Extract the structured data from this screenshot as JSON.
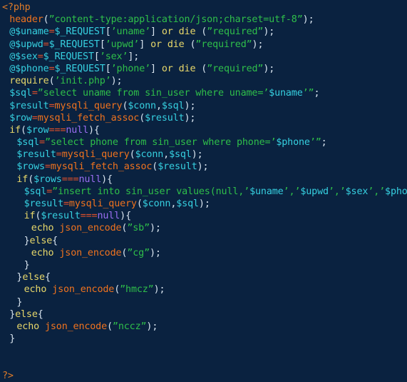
{
  "editor": {
    "name": "php-source-view",
    "language": "PHP",
    "background_color": "#0a2240",
    "colors": {
      "tag": "#e07b28",
      "keyword": "#e8d86a",
      "function": "#f0731e",
      "variable": "#36d0e0",
      "string": "#2fbf4a",
      "null_literal": "#9b6ef3",
      "operator": "#e0502a",
      "punctuation": "#d8e4ef"
    },
    "lines": [
      {
        "indent": 0,
        "tokens": [
          {
            "t": "<?php",
            "c": "tag"
          }
        ]
      },
      {
        "indent": 1,
        "tokens": [
          {
            "t": "header",
            "c": "fn"
          },
          {
            "t": "(",
            "c": "punct"
          },
          {
            "t": "”content-type:application/json;charset=utf-8”",
            "c": "str"
          },
          {
            "t": ")",
            "c": "punct"
          },
          {
            "t": ";",
            "c": "punct"
          }
        ]
      },
      {
        "indent": 1,
        "tokens": [
          {
            "t": "@$uname",
            "c": "var"
          },
          {
            "t": "=",
            "c": "op"
          },
          {
            "t": "$_REQUEST",
            "c": "var"
          },
          {
            "t": "[",
            "c": "punct"
          },
          {
            "t": "’uname’",
            "c": "str"
          },
          {
            "t": "]",
            "c": "punct"
          },
          {
            "t": " ",
            "c": "plain"
          },
          {
            "t": "or",
            "c": "kw"
          },
          {
            "t": " ",
            "c": "plain"
          },
          {
            "t": "die",
            "c": "kw"
          },
          {
            "t": " ",
            "c": "plain"
          },
          {
            "t": "(",
            "c": "punct"
          },
          {
            "t": "”required”",
            "c": "str"
          },
          {
            "t": ")",
            "c": "punct"
          },
          {
            "t": ";",
            "c": "punct"
          }
        ]
      },
      {
        "indent": 1,
        "tokens": [
          {
            "t": "@$upwd",
            "c": "var"
          },
          {
            "t": "=",
            "c": "op"
          },
          {
            "t": "$_REQUEST",
            "c": "var"
          },
          {
            "t": "[",
            "c": "punct"
          },
          {
            "t": "’upwd’",
            "c": "str"
          },
          {
            "t": "]",
            "c": "punct"
          },
          {
            "t": " ",
            "c": "plain"
          },
          {
            "t": "or",
            "c": "kw"
          },
          {
            "t": " ",
            "c": "plain"
          },
          {
            "t": "die",
            "c": "kw"
          },
          {
            "t": " ",
            "c": "plain"
          },
          {
            "t": "(",
            "c": "punct"
          },
          {
            "t": "”required”",
            "c": "str"
          },
          {
            "t": ")",
            "c": "punct"
          },
          {
            "t": ";",
            "c": "punct"
          }
        ]
      },
      {
        "indent": 1,
        "tokens": [
          {
            "t": "@$sex",
            "c": "var"
          },
          {
            "t": "=",
            "c": "op"
          },
          {
            "t": "$_REQUEST",
            "c": "var"
          },
          {
            "t": "[",
            "c": "punct"
          },
          {
            "t": "’sex’",
            "c": "str"
          },
          {
            "t": "]",
            "c": "punct"
          },
          {
            "t": ";",
            "c": "punct"
          }
        ]
      },
      {
        "indent": 1,
        "tokens": [
          {
            "t": "@$phone",
            "c": "var"
          },
          {
            "t": "=",
            "c": "op"
          },
          {
            "t": "$_REQUEST",
            "c": "var"
          },
          {
            "t": "[",
            "c": "punct"
          },
          {
            "t": "’phone’",
            "c": "str"
          },
          {
            "t": "]",
            "c": "punct"
          },
          {
            "t": " ",
            "c": "plain"
          },
          {
            "t": "or",
            "c": "kw"
          },
          {
            "t": " ",
            "c": "plain"
          },
          {
            "t": "die",
            "c": "kw"
          },
          {
            "t": " ",
            "c": "plain"
          },
          {
            "t": "(",
            "c": "punct"
          },
          {
            "t": "”required”",
            "c": "str"
          },
          {
            "t": ")",
            "c": "punct"
          },
          {
            "t": ";",
            "c": "punct"
          }
        ]
      },
      {
        "indent": 1,
        "tokens": [
          {
            "t": "require",
            "c": "kw"
          },
          {
            "t": "(",
            "c": "punct"
          },
          {
            "t": "’init.php’",
            "c": "str"
          },
          {
            "t": ")",
            "c": "punct"
          },
          {
            "t": ";",
            "c": "punct"
          }
        ]
      },
      {
        "indent": 1,
        "tokens": [
          {
            "t": "$sql",
            "c": "var"
          },
          {
            "t": "=",
            "c": "op"
          },
          {
            "t": "”select uname from sin_user where uname=’",
            "c": "str"
          },
          {
            "t": "$uname",
            "c": "var"
          },
          {
            "t": "’”",
            "c": "str"
          },
          {
            "t": ";",
            "c": "punct"
          }
        ]
      },
      {
        "indent": 1,
        "tokens": [
          {
            "t": "$result",
            "c": "var"
          },
          {
            "t": "=",
            "c": "op"
          },
          {
            "t": "mysqli_query",
            "c": "fn"
          },
          {
            "t": "(",
            "c": "punct"
          },
          {
            "t": "$conn",
            "c": "var"
          },
          {
            "t": ",",
            "c": "punct"
          },
          {
            "t": "$sql",
            "c": "var"
          },
          {
            "t": ")",
            "c": "punct"
          },
          {
            "t": ";",
            "c": "punct"
          }
        ]
      },
      {
        "indent": 1,
        "tokens": [
          {
            "t": "$row",
            "c": "var"
          },
          {
            "t": "=",
            "c": "op"
          },
          {
            "t": "mysqli_fetch_assoc",
            "c": "fn"
          },
          {
            "t": "(",
            "c": "punct"
          },
          {
            "t": "$result",
            "c": "var"
          },
          {
            "t": ")",
            "c": "punct"
          },
          {
            "t": ";",
            "c": "punct"
          }
        ]
      },
      {
        "indent": 1,
        "tokens": [
          {
            "t": "if",
            "c": "kw"
          },
          {
            "t": "(",
            "c": "punct"
          },
          {
            "t": "$row",
            "c": "var"
          },
          {
            "t": "===",
            "c": "op"
          },
          {
            "t": "null",
            "c": "null"
          },
          {
            "t": ")",
            "c": "punct"
          },
          {
            "t": "{",
            "c": "punct"
          }
        ]
      },
      {
        "indent": 2,
        "tokens": [
          {
            "t": "$sql",
            "c": "var"
          },
          {
            "t": "=",
            "c": "op"
          },
          {
            "t": "”select phone from sin_user where phone=’",
            "c": "str"
          },
          {
            "t": "$phone",
            "c": "var"
          },
          {
            "t": "’”",
            "c": "str"
          },
          {
            "t": ";",
            "c": "punct"
          }
        ]
      },
      {
        "indent": 2,
        "tokens": [
          {
            "t": "$result",
            "c": "var"
          },
          {
            "t": "=",
            "c": "op"
          },
          {
            "t": "mysqli_query",
            "c": "fn"
          },
          {
            "t": "(",
            "c": "punct"
          },
          {
            "t": "$conn",
            "c": "var"
          },
          {
            "t": ",",
            "c": "punct"
          },
          {
            "t": "$sql",
            "c": "var"
          },
          {
            "t": ")",
            "c": "punct"
          },
          {
            "t": ";",
            "c": "punct"
          }
        ]
      },
      {
        "indent": 2,
        "tokens": [
          {
            "t": "$rows",
            "c": "var"
          },
          {
            "t": "=",
            "c": "op"
          },
          {
            "t": "mysqli_fetch_assoc",
            "c": "fn"
          },
          {
            "t": "(",
            "c": "punct"
          },
          {
            "t": "$result",
            "c": "var"
          },
          {
            "t": ")",
            "c": "punct"
          },
          {
            "t": ";",
            "c": "punct"
          }
        ]
      },
      {
        "indent": 2,
        "tokens": [
          {
            "t": "if",
            "c": "kw"
          },
          {
            "t": "(",
            "c": "punct"
          },
          {
            "t": "$rows",
            "c": "var"
          },
          {
            "t": "===",
            "c": "op"
          },
          {
            "t": "null",
            "c": "null"
          },
          {
            "t": ")",
            "c": "punct"
          },
          {
            "t": "{",
            "c": "punct"
          }
        ]
      },
      {
        "indent": 3,
        "tokens": [
          {
            "t": "$sql",
            "c": "var"
          },
          {
            "t": "=",
            "c": "op"
          },
          {
            "t": "”insert into sin_user values(null,’",
            "c": "str"
          },
          {
            "t": "$uname",
            "c": "var"
          },
          {
            "t": "’,’",
            "c": "str"
          },
          {
            "t": "$upwd",
            "c": "var"
          },
          {
            "t": "’,’",
            "c": "str"
          },
          {
            "t": "$sex",
            "c": "var"
          },
          {
            "t": "’,’",
            "c": "str"
          },
          {
            "t": "$phone",
            "c": "var"
          },
          {
            "t": "’)”",
            "c": "str"
          },
          {
            "t": ";",
            "c": "punct"
          }
        ]
      },
      {
        "indent": 3,
        "tokens": [
          {
            "t": "$result",
            "c": "var"
          },
          {
            "t": "=",
            "c": "op"
          },
          {
            "t": "mysqli_query",
            "c": "fn"
          },
          {
            "t": "(",
            "c": "punct"
          },
          {
            "t": "$conn",
            "c": "var"
          },
          {
            "t": ",",
            "c": "punct"
          },
          {
            "t": "$sql",
            "c": "var"
          },
          {
            "t": ")",
            "c": "punct"
          },
          {
            "t": ";",
            "c": "punct"
          }
        ]
      },
      {
        "indent": 3,
        "tokens": [
          {
            "t": "if",
            "c": "kw"
          },
          {
            "t": "(",
            "c": "punct"
          },
          {
            "t": "$result",
            "c": "var"
          },
          {
            "t": "===",
            "c": "op"
          },
          {
            "t": "null",
            "c": "null"
          },
          {
            "t": ")",
            "c": "punct"
          },
          {
            "t": "{",
            "c": "punct"
          }
        ]
      },
      {
        "indent": 4,
        "tokens": [
          {
            "t": "echo",
            "c": "kw"
          },
          {
            "t": " ",
            "c": "plain"
          },
          {
            "t": "json_encode",
            "c": "fn"
          },
          {
            "t": "(",
            "c": "punct"
          },
          {
            "t": "”sb”",
            "c": "str"
          },
          {
            "t": ")",
            "c": "punct"
          },
          {
            "t": ";",
            "c": "punct"
          }
        ]
      },
      {
        "indent": 3,
        "tokens": [
          {
            "t": "}",
            "c": "punct"
          },
          {
            "t": "else",
            "c": "kw"
          },
          {
            "t": "{",
            "c": "punct"
          }
        ]
      },
      {
        "indent": 4,
        "tokens": [
          {
            "t": "echo",
            "c": "kw"
          },
          {
            "t": " ",
            "c": "plain"
          },
          {
            "t": "json_encode",
            "c": "fn"
          },
          {
            "t": "(",
            "c": "punct"
          },
          {
            "t": "”cg”",
            "c": "str"
          },
          {
            "t": ")",
            "c": "punct"
          },
          {
            "t": ";",
            "c": "punct"
          }
        ]
      },
      {
        "indent": 3,
        "tokens": [
          {
            "t": "}",
            "c": "punct"
          }
        ]
      },
      {
        "indent": 2,
        "tokens": [
          {
            "t": "}",
            "c": "punct"
          },
          {
            "t": "else",
            "c": "kw"
          },
          {
            "t": "{",
            "c": "punct"
          }
        ]
      },
      {
        "indent": 3,
        "tokens": [
          {
            "t": "echo",
            "c": "kw"
          },
          {
            "t": " ",
            "c": "plain"
          },
          {
            "t": "json_encode",
            "c": "fn"
          },
          {
            "t": "(",
            "c": "punct"
          },
          {
            "t": "”hmcz”",
            "c": "str"
          },
          {
            "t": ")",
            "c": "punct"
          },
          {
            "t": ";",
            "c": "punct"
          }
        ]
      },
      {
        "indent": 2,
        "tokens": [
          {
            "t": "}",
            "c": "punct"
          }
        ]
      },
      {
        "indent": 1,
        "tokens": [
          {
            "t": "}",
            "c": "punct"
          },
          {
            "t": "else",
            "c": "kw"
          },
          {
            "t": "{",
            "c": "punct"
          }
        ]
      },
      {
        "indent": 2,
        "tokens": [
          {
            "t": "echo",
            "c": "kw"
          },
          {
            "t": " ",
            "c": "plain"
          },
          {
            "t": "json_encode",
            "c": "fn"
          },
          {
            "t": "(",
            "c": "punct"
          },
          {
            "t": "”nccz”",
            "c": "str"
          },
          {
            "t": ")",
            "c": "punct"
          },
          {
            "t": ";",
            "c": "punct"
          }
        ]
      },
      {
        "indent": 1,
        "tokens": [
          {
            "t": "}",
            "c": "punct"
          }
        ]
      },
      {
        "indent": 0,
        "tokens": []
      },
      {
        "indent": 0,
        "tokens": []
      },
      {
        "indent": 0,
        "tokens": [
          {
            "t": "?>",
            "c": "tag"
          }
        ]
      }
    ]
  }
}
